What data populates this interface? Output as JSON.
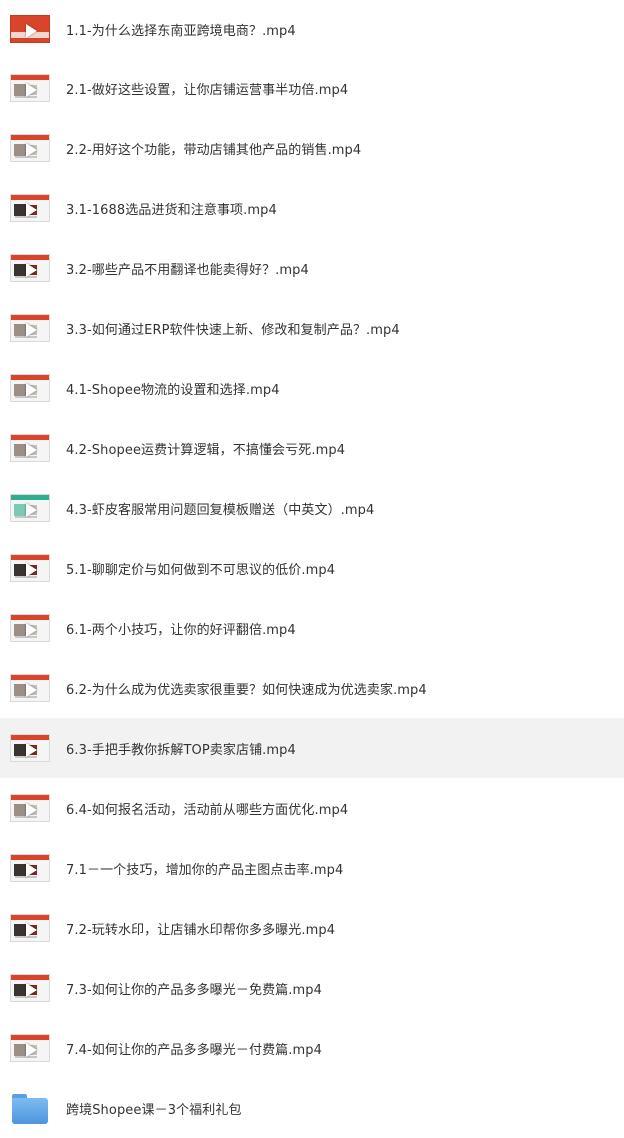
{
  "colors": {
    "text": "#333333",
    "hover_row": "#f2f2f2",
    "thumb_accent": "#d9452b",
    "folder": "#5b9fe0"
  },
  "files": [
    {
      "name": "1.1-为什么选择东南亚跨境电商？.mp4",
      "icon": "video-thumbnail-icon"
    },
    {
      "name": "2.1-做好这些设置，让你店铺运营事半功倍.mp4",
      "icon": "video-thumbnail-icon"
    },
    {
      "name": "2.2-用好这个功能，带动店铺其他产品的销售.mp4",
      "icon": "video-thumbnail-icon"
    },
    {
      "name": "3.1-1688选品进货和注意事项.mp4",
      "icon": "video-thumbnail-icon"
    },
    {
      "name": "3.2-哪些产品不用翻译也能卖得好？.mp4",
      "icon": "video-thumbnail-icon"
    },
    {
      "name": "3.3-如何通过ERP软件快速上新、修改和复制产品？.mp4",
      "icon": "video-thumbnail-icon"
    },
    {
      "name": "4.1-Shopee物流的设置和选择.mp4",
      "icon": "video-thumbnail-icon"
    },
    {
      "name": "4.2-Shopee运费计算逻辑，不搞懂会亏死.mp4",
      "icon": "video-thumbnail-icon"
    },
    {
      "name": "4.3-虾皮客服常用问题回复模板赠送（中英文）.mp4",
      "icon": "video-thumbnail-icon"
    },
    {
      "name": "5.1-聊聊定价与如何做到不可思议的低价.mp4",
      "icon": "video-thumbnail-icon"
    },
    {
      "name": "6.1-两个小技巧，让你的好评翻倍.mp4",
      "icon": "video-thumbnail-icon"
    },
    {
      "name": "6.2-为什么成为优选卖家很重要？如何快速成为优选卖家.mp4",
      "icon": "video-thumbnail-icon"
    },
    {
      "name": "6.3-手把手教你拆解TOP卖家店铺.mp4",
      "icon": "video-thumbnail-icon"
    },
    {
      "name": "6.4-如何报名活动，活动前从哪些方面优化.mp4",
      "icon": "video-thumbnail-icon"
    },
    {
      "name": "7.1－一个技巧，增加你的产品主图点击率.mp4",
      "icon": "video-thumbnail-icon"
    },
    {
      "name": "7.2-玩转水印，让店铺水印帮你多多曝光.mp4",
      "icon": "video-thumbnail-icon"
    },
    {
      "name": "7.3-如何让你的产品多多曝光－免费篇.mp4",
      "icon": "video-thumbnail-icon"
    },
    {
      "name": "7.4-如何让你的产品多多曝光－付费篇.mp4",
      "icon": "video-thumbnail-icon"
    }
  ],
  "folder": {
    "name": "跨境Shopee课－3个福利礼包",
    "icon": "folder-icon"
  }
}
